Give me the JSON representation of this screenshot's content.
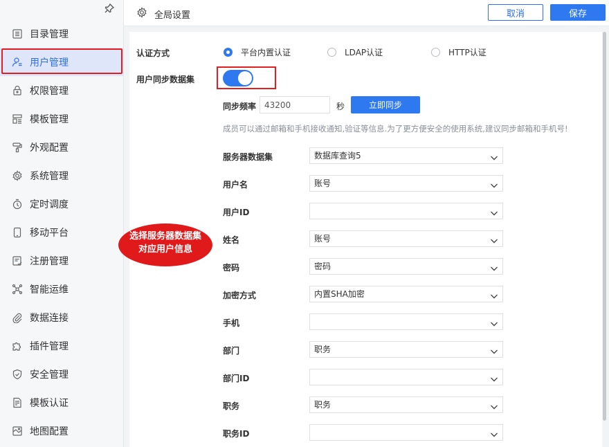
{
  "sidebar": {
    "items": [
      {
        "label": "目录管理",
        "icon": "list-icon"
      },
      {
        "label": "用户管理",
        "icon": "user-icon",
        "active": true
      },
      {
        "label": "权限管理",
        "icon": "lock-icon"
      },
      {
        "label": "模板管理",
        "icon": "template-icon"
      },
      {
        "label": "外观配置",
        "icon": "paint-roller-icon"
      },
      {
        "label": "系统管理",
        "icon": "gear-icon"
      },
      {
        "label": "定时调度",
        "icon": "timer-icon"
      },
      {
        "label": "移动平台",
        "icon": "mobile-icon"
      },
      {
        "label": "注册管理",
        "icon": "register-icon"
      },
      {
        "label": "智能运维",
        "icon": "network-icon"
      },
      {
        "label": "数据连接",
        "icon": "paperclip-icon"
      },
      {
        "label": "插件管理",
        "icon": "puzzle-icon"
      },
      {
        "label": "安全管理",
        "icon": "shield-icon"
      },
      {
        "label": "模板认证",
        "icon": "document-check-icon"
      },
      {
        "label": "地图配置",
        "icon": "map-icon"
      }
    ]
  },
  "header": {
    "title": "全局设置",
    "cancel_label": "取消",
    "save_label": "保存"
  },
  "auth": {
    "label": "认证方式",
    "options": [
      "平台内置认证",
      "LDAP认证",
      "HTTP认证"
    ],
    "selected": "平台内置认证"
  },
  "sync": {
    "label": "用户同步数据集",
    "enabled": true,
    "freq_label": "同步频率",
    "freq_value": "43200",
    "freq_unit": "秒",
    "sync_now_label": "立即同步",
    "hint": "成员可以通过邮箱和手机接收通知,验证等信息.为了更方便安全的使用系统,建议同步邮箱和手机号!"
  },
  "fields": [
    {
      "label": "服务器数据集",
      "value": "数据库查询5"
    },
    {
      "label": "用户名",
      "value": "账号"
    },
    {
      "label": "用户ID",
      "value": ""
    },
    {
      "label": "姓名",
      "value": "账号"
    },
    {
      "label": "密码",
      "value": "密码"
    },
    {
      "label": "加密方式",
      "value": "内置SHA加密"
    },
    {
      "label": "手机",
      "value": ""
    },
    {
      "label": "部门",
      "value": "职务"
    },
    {
      "label": "部门ID",
      "value": ""
    },
    {
      "label": "职务",
      "value": "职务"
    },
    {
      "label": "职务ID",
      "value": ""
    }
  ],
  "callout": {
    "line1": "选择服务器数据集",
    "line2": "对应用户信息"
  },
  "colors": {
    "accent": "#2f79f0",
    "highlight": "#e02020",
    "active_bg": "#dfe6fa"
  }
}
